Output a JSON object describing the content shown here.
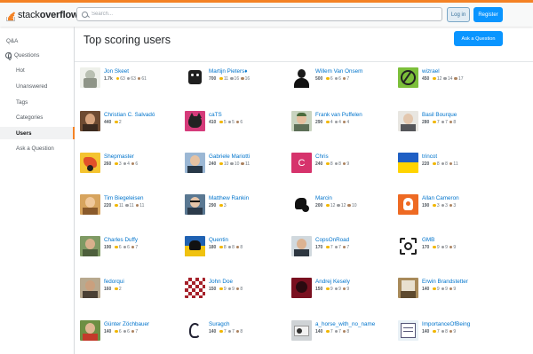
{
  "header": {
    "logo_text_light": "stack",
    "logo_text_bold": "overflow",
    "search_placeholder": "Search...",
    "login_label": "Log in",
    "register_label": "Register",
    "colors": {
      "accent": "#f48225",
      "primary": "#0a95ff"
    }
  },
  "sidebar": {
    "items": [
      {
        "label": "Q&A"
      },
      {
        "label": "Questions",
        "icon": "globe-icon"
      },
      {
        "label": "Hot"
      },
      {
        "label": "Unanswered"
      },
      {
        "label": "Tags"
      },
      {
        "label": "Categories"
      },
      {
        "label": "Users",
        "active": true
      },
      {
        "label": "Ask a Question"
      }
    ]
  },
  "main": {
    "title": "Top scoring users",
    "ask_button": "Ask a Question",
    "users": [
      {
        "name": "Jon Skeet",
        "rep": "1.7k",
        "gold": "63",
        "silver": "63",
        "bronze": "61"
      },
      {
        "name": "Martijn Pieters♦",
        "rep": "700",
        "gold": "11",
        "silver": "16",
        "bronze": "16"
      },
      {
        "name": "Willem Van Onsem",
        "rep": "500",
        "gold": "6",
        "silver": "6",
        "bronze": "7"
      },
      {
        "name": "wizrael",
        "rep": "450",
        "gold": "12",
        "silver": "14",
        "bronze": "17"
      },
      {
        "name": "Christian C. Salvadó",
        "rep": "440",
        "gold": "2",
        "silver": "",
        "bronze": ""
      },
      {
        "name": "caTS",
        "rep": "410",
        "gold": "5",
        "silver": "5",
        "bronze": "6"
      },
      {
        "name": "Frank van Puffelen",
        "rep": "290",
        "gold": "4",
        "silver": "4",
        "bronze": "4"
      },
      {
        "name": "Basil Bourque",
        "rep": "280",
        "gold": "7",
        "silver": "7",
        "bronze": "8"
      },
      {
        "name": "Shepmaster",
        "rep": "260",
        "gold": "3",
        "silver": "4",
        "bronze": "6"
      },
      {
        "name": "Gabriele Mariotti",
        "rep": "240",
        "gold": "10",
        "silver": "10",
        "bronze": "11"
      },
      {
        "name": "Chris",
        "rep": "240",
        "gold": "8",
        "silver": "8",
        "bronze": "9"
      },
      {
        "name": "trincot",
        "rep": "220",
        "gold": "8",
        "silver": "8",
        "bronze": "11"
      },
      {
        "name": "Tim Biegeleisen",
        "rep": "220",
        "gold": "11",
        "silver": "11",
        "bronze": "11"
      },
      {
        "name": "Matthew Rankin",
        "rep": "290",
        "gold": "3",
        "silver": "",
        "bronze": ""
      },
      {
        "name": "Marcin",
        "rep": "200",
        "gold": "12",
        "silver": "12",
        "bronze": "10"
      },
      {
        "name": "Allan Cameron",
        "rep": "190",
        "gold": "3",
        "silver": "3",
        "bronze": "3"
      },
      {
        "name": "Charles Duffy",
        "rep": "190",
        "gold": "6",
        "silver": "6",
        "bronze": "7"
      },
      {
        "name": "Quentin",
        "rep": "180",
        "gold": "8",
        "silver": "8",
        "bronze": "8"
      },
      {
        "name": "CopsOnRoad",
        "rep": "170",
        "gold": "7",
        "silver": "7",
        "bronze": "7"
      },
      {
        "name": "GMB",
        "rep": "170",
        "gold": "9",
        "silver": "9",
        "bronze": "9"
      },
      {
        "name": "fedorqui",
        "rep": "160",
        "gold": "2",
        "silver": "",
        "bronze": ""
      },
      {
        "name": "John Doe",
        "rep": "150",
        "gold": "9",
        "silver": "9",
        "bronze": "8"
      },
      {
        "name": "Andrej Kesely",
        "rep": "150",
        "gold": "9",
        "silver": "9",
        "bronze": "9"
      },
      {
        "name": "Erwin Brandstetter",
        "rep": "140",
        "gold": "9",
        "silver": "9",
        "bronze": "9"
      },
      {
        "name": "Günter Zöchbauer",
        "rep": "140",
        "gold": "6",
        "silver": "6",
        "bronze": "7"
      },
      {
        "name": "Suragch",
        "rep": "140",
        "gold": "7",
        "silver": "7",
        "bronze": "8"
      },
      {
        "name": "a_horse_with_no_name",
        "rep": "140",
        "gold": "7",
        "silver": "7",
        "bronze": "8"
      },
      {
        "name": "ImportanceOfBeing",
        "rep": "140",
        "gold": "7",
        "silver": "8",
        "bronze": "9"
      }
    ]
  }
}
